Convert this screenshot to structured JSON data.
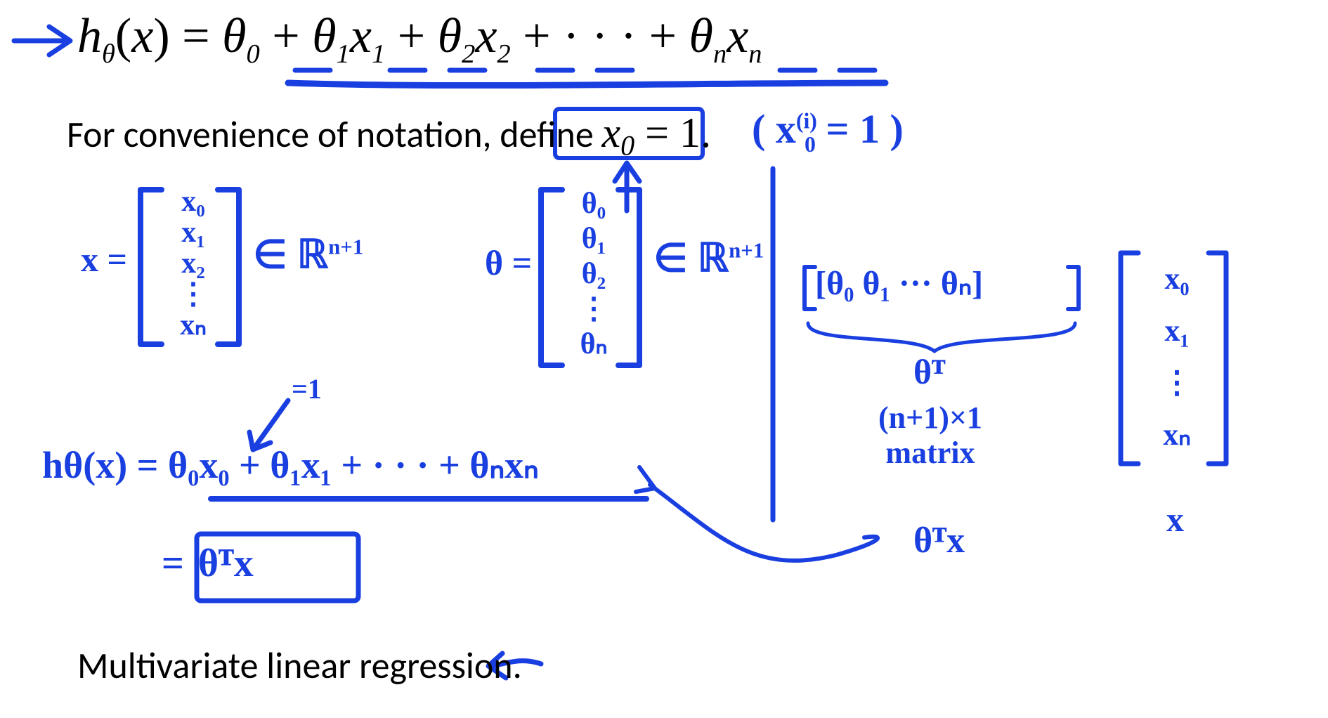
{
  "hypothesis_typed": {
    "lhs_h": "h",
    "lhs_theta": "θ",
    "lhs_open": "(",
    "lhs_x": "x",
    "lhs_close": ")",
    "eq": " = ",
    "t0_theta": "θ",
    "t0_sub": "0",
    "plus1": " + ",
    "t1_theta": "θ",
    "t1_sub": "1",
    "t1_x": "x",
    "t1_xsub": "1",
    "plus2": " + ",
    "t2_theta": "θ",
    "t2_sub": "2",
    "t2_x": "x",
    "t2_xsub": "2",
    "plus3": " + · · · + ",
    "tn_theta": "θ",
    "tn_sub": "n",
    "tn_x": "x",
    "tn_xsub": "n"
  },
  "convenience_line": {
    "prefix": "For convenience of notation, define ",
    "x": "x",
    "xsub": "0",
    "eq": " = 1.",
    "period": ""
  },
  "x0i_note": {
    "open": "( ",
    "x": "x",
    "sup": "(i)",
    "sub": "0",
    "eq": " = 1 )",
    "close": ""
  },
  "x_vector": {
    "label": "x =",
    "entries": [
      "x₀",
      "x₁",
      "x₂",
      "⋮",
      "xₙ"
    ],
    "space": "∈ ℝ",
    "exp": "n+1"
  },
  "theta_vector": {
    "label": "θ =",
    "entries": [
      "θ₀",
      "θ₁",
      "θ₂",
      "⋮",
      "θₙ"
    ],
    "space": "∈ ℝ",
    "exp": "n+1"
  },
  "arrow_eq1_label": "=1",
  "hypothesis_hand": {
    "text": "hθ(x) = θ₀x₀ + θ₁x₁ + · · · + θₙxₙ"
  },
  "theta_T_x_box": {
    "prefix": "= ",
    "body": "θᵀx"
  },
  "theta_transpose_row": {
    "row": "[θ₀ θ₁ ··· θₙ]",
    "label_thetaT": "θᵀ",
    "matrix_size": "(n+1)×1",
    "matrix_word": "matrix",
    "result": "θᵀx"
  },
  "x_vector_right": {
    "entries": [
      "x₀",
      "x₁",
      "⋮",
      "xₙ"
    ],
    "label": "x"
  },
  "footer": "Multivariate linear regression."
}
